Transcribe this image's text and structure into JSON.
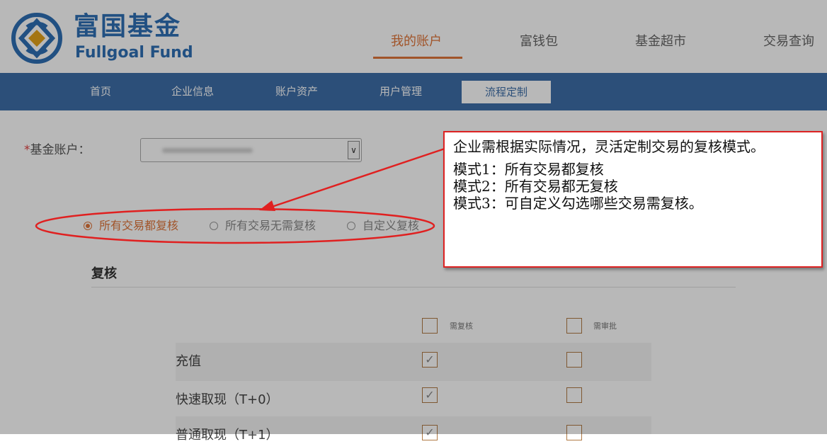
{
  "logo": {
    "name_cn": "富国基金",
    "name_en": "Fullgoal Fund"
  },
  "topnav": {
    "items": [
      {
        "label": "我的账户",
        "active": true
      },
      {
        "label": "富钱包",
        "active": false
      },
      {
        "label": "基金超市",
        "active": false
      },
      {
        "label": "交易查询",
        "active": false
      }
    ]
  },
  "subnav": {
    "items": [
      {
        "label": "首页"
      },
      {
        "label": "企业信息"
      },
      {
        "label": "账户资产"
      },
      {
        "label": "用户管理"
      },
      {
        "label": "流程定制",
        "active": true
      }
    ]
  },
  "form": {
    "required_mark": "*",
    "fund_account_label": "基金账户：",
    "fund_account_value_blurred": true
  },
  "review_mode": {
    "options": [
      {
        "label": "所有交易都复核",
        "selected": true
      },
      {
        "label": "所有交易无需复核",
        "selected": false
      },
      {
        "label": "自定义复核",
        "selected": false
      }
    ]
  },
  "review_section": {
    "title": "复核",
    "col_headers": [
      "需复核",
      "需审批"
    ],
    "rows": [
      {
        "label": "充值",
        "need_review": true,
        "need_approval": false
      },
      {
        "label": "快速取现（T+0）",
        "need_review": true,
        "need_approval": false
      },
      {
        "label": "普通取现（T+1）",
        "need_review": true,
        "need_approval": false
      }
    ]
  },
  "callout": {
    "line1": "企业需根据实际情况，灵活定制交易的复核模式。",
    "mode1": "模式1：所有交易都复核",
    "mode2": "模式2：所有交易都无复核",
    "mode3": "模式3：可自定义勾选哪些交易需复核。"
  },
  "colors": {
    "brand_blue": "#2f6fb4",
    "nav_blue": "#3d6ea8",
    "accent_orange": "#e0753a",
    "annotation_red": "#dd2222"
  }
}
